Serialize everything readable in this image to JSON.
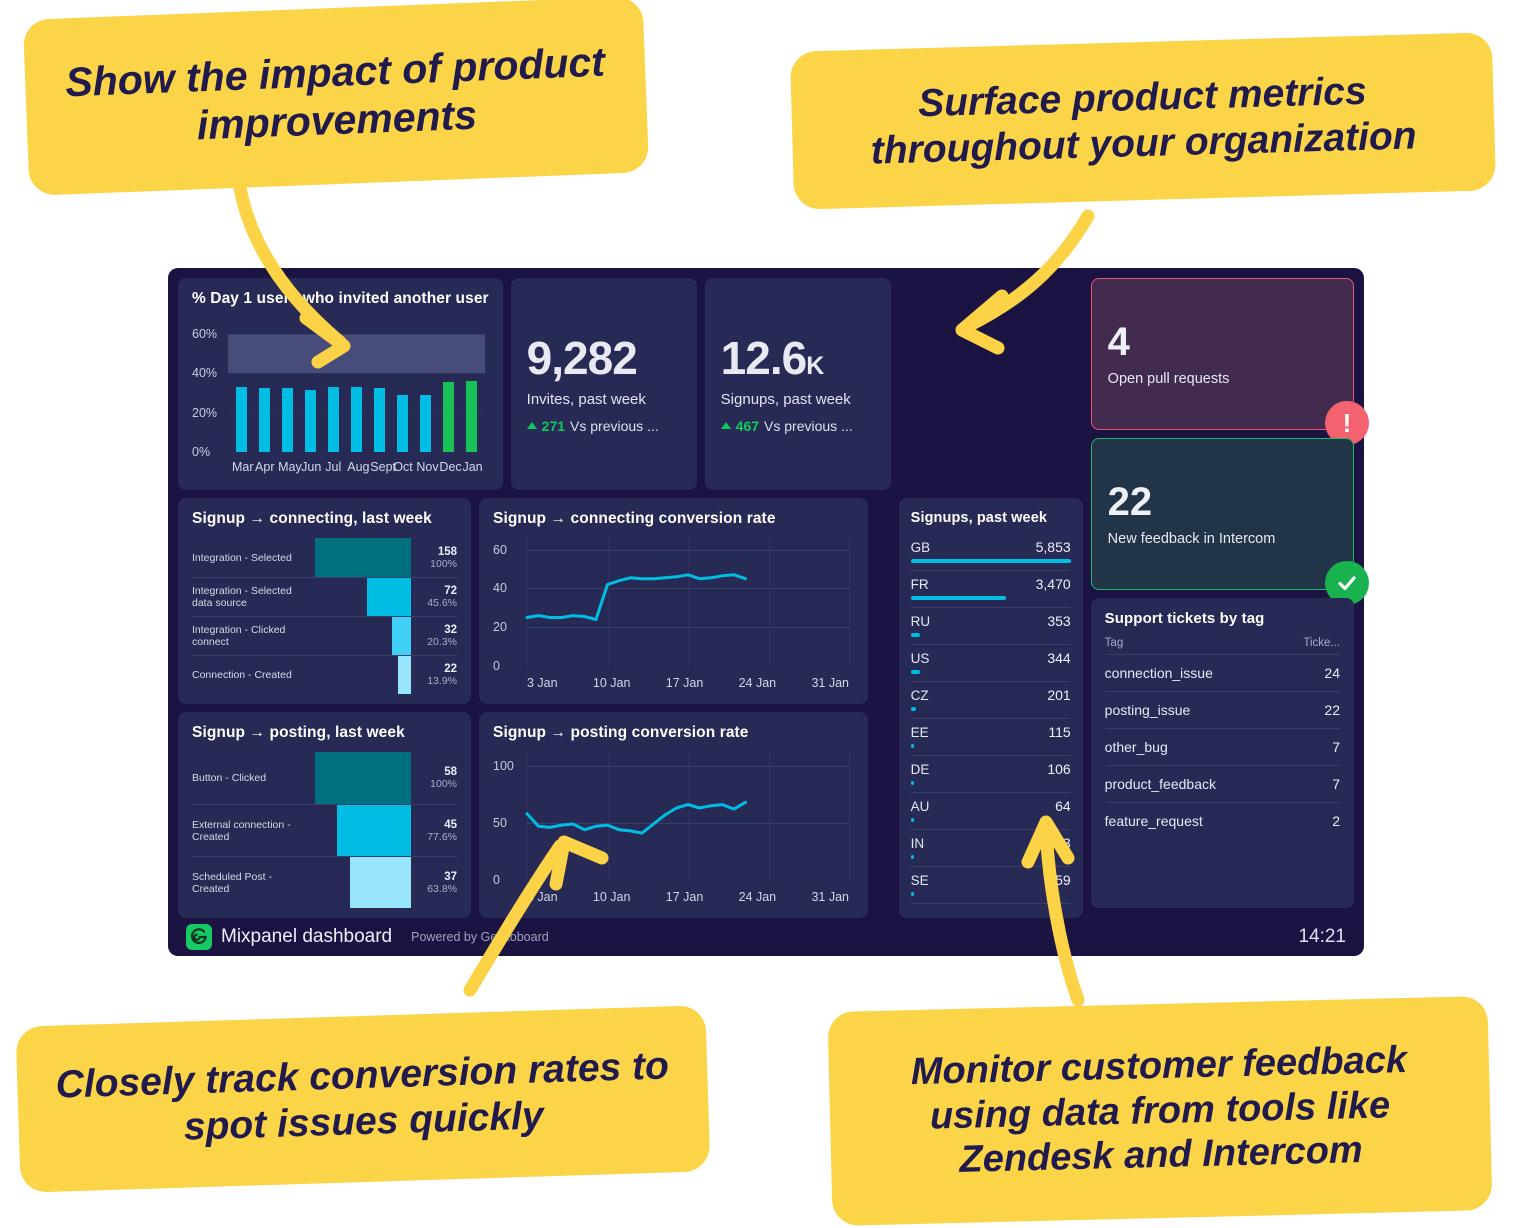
{
  "callouts": [
    {
      "id": "impact",
      "text": "Show the impact of product improvements"
    },
    {
      "id": "surface",
      "text": "Surface product metrics throughout your organization"
    },
    {
      "id": "conversion",
      "text": "Closely track conversion rates to spot issues quickly"
    },
    {
      "id": "feedback",
      "text": "Monitor customer feedback using data from tools like Zendesk and Intercom"
    }
  ],
  "footer": {
    "title": "Mixpanel dashboard",
    "powered_by": "Powered by Geckoboard",
    "clock": "14:21",
    "logo_icon": "geckoboard-logo-icon"
  },
  "colors": {
    "accent_cyan": "#00bde3",
    "accent_green": "#19c257",
    "callout_yellow": "#fcd447",
    "card_bg": "#272a54",
    "dashboard_bg": "#1b1442",
    "alert_red": "#f4616f",
    "success_green": "#18b34f"
  },
  "kpis": [
    {
      "value": "9,282",
      "suffix": "",
      "label": "Invites, past week",
      "delta": "271",
      "delta_text": "Vs previous ...",
      "direction": "up"
    },
    {
      "value": "12.6",
      "suffix": "K",
      "label": "Signups, past week",
      "delta": "467",
      "delta_text": "Vs previous ...",
      "direction": "up"
    }
  ],
  "status_tiles": [
    {
      "value": "4",
      "label": "Open pull requests",
      "badge": "alert-icon",
      "badge_glyph": "!"
    },
    {
      "value": "22",
      "label": "New feedback in Intercom",
      "badge": "check-icon",
      "badge_glyph": "✔"
    }
  ],
  "leaderboard": {
    "title": "Signups, past week",
    "rows": [
      {
        "name": "GB",
        "value": "5,853",
        "pct": 100
      },
      {
        "name": "FR",
        "value": "3,470",
        "pct": 59.3
      },
      {
        "name": "RU",
        "value": "353",
        "pct": 6.0
      },
      {
        "name": "US",
        "value": "344",
        "pct": 5.9
      },
      {
        "name": "CZ",
        "value": "201",
        "pct": 3.4
      },
      {
        "name": "EE",
        "value": "115",
        "pct": 2.0
      },
      {
        "name": "DE",
        "value": "106",
        "pct": 1.8
      },
      {
        "name": "AU",
        "value": "64",
        "pct": 1.1
      },
      {
        "name": "IN",
        "value": "63",
        "pct": 1.1
      },
      {
        "name": "SE",
        "value": "59",
        "pct": 1.0
      }
    ]
  },
  "tickets": {
    "title": "Support tickets by tag",
    "columns": [
      "Tag",
      "Ticke..."
    ],
    "rows": [
      {
        "tag": "connection_issue",
        "count": "24"
      },
      {
        "tag": "posting_issue",
        "count": "22"
      },
      {
        "tag": "other_bug",
        "count": "7"
      },
      {
        "tag": "product_feedback",
        "count": "7"
      },
      {
        "tag": "feature_request",
        "count": "2"
      }
    ]
  },
  "chart_data": [
    {
      "id": "day1-invites-bar",
      "type": "bar",
      "title": "% Day 1 users who invited another user",
      "categories": [
        "Mar",
        "Apr",
        "May",
        "Jun",
        "Jul",
        "Aug",
        "Sept",
        "Oct",
        "Nov",
        "Dec",
        "Jan"
      ],
      "values": [
        33,
        32.5,
        32.5,
        31.5,
        33,
        33,
        32.5,
        29,
        29,
        35.5,
        36
      ],
      "colors": [
        "#00bde3",
        "#00bde3",
        "#00bde3",
        "#00bde3",
        "#00bde3",
        "#00bde3",
        "#00bde3",
        "#00bde3",
        "#00bde3",
        "#19c257",
        "#19c257"
      ],
      "ytick_labels": [
        "60%",
        "40%",
        "20%",
        "0%"
      ],
      "ytick_values": [
        60,
        40,
        20,
        0
      ],
      "ylim": [
        0,
        66
      ],
      "goal_band": {
        "from": 40,
        "to": 60,
        "color": "#474c7b"
      },
      "xlabel": "",
      "ylabel": "",
      "grid": true,
      "legend": "none"
    },
    {
      "id": "funnel-connecting",
      "type": "bar",
      "title": "Signup → connecting, last week",
      "categories": [
        "Integration - Selected",
        "Integration - Selected data source",
        "Integration - Clicked connect",
        "Connection - Created"
      ],
      "values": [
        158,
        72,
        32,
        22
      ],
      "labels_pct": [
        "100%",
        "45.6%",
        "20.3%",
        "13.9%"
      ],
      "colors": [
        "#00707f",
        "#00bde3",
        "#41d0f5",
        "#96e5fa"
      ],
      "xlabel": "",
      "ylabel": "",
      "grid": false,
      "legend": "none"
    },
    {
      "id": "funnel-posting",
      "type": "bar",
      "title": "Signup → posting, last week",
      "categories": [
        "Button - Clicked",
        "External connection - Created",
        "Scheduled Post - Created"
      ],
      "values": [
        58,
        45,
        37
      ],
      "labels_pct": [
        "100%",
        "77.6%",
        "63.8%"
      ],
      "colors": [
        "#00707f",
        "#00bde3",
        "#96e5fa"
      ],
      "xlabel": "",
      "ylabel": "",
      "grid": false,
      "legend": "none"
    },
    {
      "id": "connecting-conversion-line",
      "type": "line",
      "title": "Signup → connecting conversion rate",
      "ytick_labels": [
        "60",
        "40",
        "20",
        "0"
      ],
      "ytick_values": [
        60,
        40,
        20,
        0
      ],
      "ylim": [
        0,
        66
      ],
      "xtick_labels": [
        "3 Jan",
        "10 Jan",
        "17 Jan",
        "24 Jan",
        "31 Jan"
      ],
      "x": [
        3,
        4,
        5,
        6,
        7,
        8,
        9,
        10,
        11,
        12,
        13,
        14,
        15,
        16,
        17,
        18,
        19,
        20,
        21,
        22
      ],
      "values": [
        25,
        26,
        25,
        25,
        26,
        25.5,
        24,
        42,
        44,
        45.5,
        45,
        45,
        45.5,
        46,
        47,
        45,
        45.5,
        46.5,
        47,
        45
      ],
      "color": "#00bde3",
      "xlabel": "",
      "ylabel": "",
      "grid": true,
      "legend": "none"
    },
    {
      "id": "posting-conversion-line",
      "type": "line",
      "title": "Signup → posting conversion rate",
      "ytick_labels": [
        "100",
        "50",
        "0"
      ],
      "ytick_values": [
        100,
        50,
        0
      ],
      "ylim": [
        0,
        112
      ],
      "xtick_labels": [
        "3 Jan",
        "10 Jan",
        "17 Jan",
        "24 Jan",
        "31 Jan"
      ],
      "x": [
        3,
        4,
        5,
        6,
        7,
        8,
        9,
        10,
        11,
        12,
        13,
        14,
        15,
        16,
        17,
        18,
        19,
        20,
        21,
        22
      ],
      "values": [
        58,
        47,
        46,
        48,
        49,
        44,
        47,
        48,
        44,
        43,
        41,
        49,
        57,
        63,
        66,
        63,
        65,
        66,
        62,
        68
      ],
      "color": "#00bde3",
      "xlabel": "",
      "ylabel": "",
      "grid": true,
      "legend": "none"
    }
  ]
}
